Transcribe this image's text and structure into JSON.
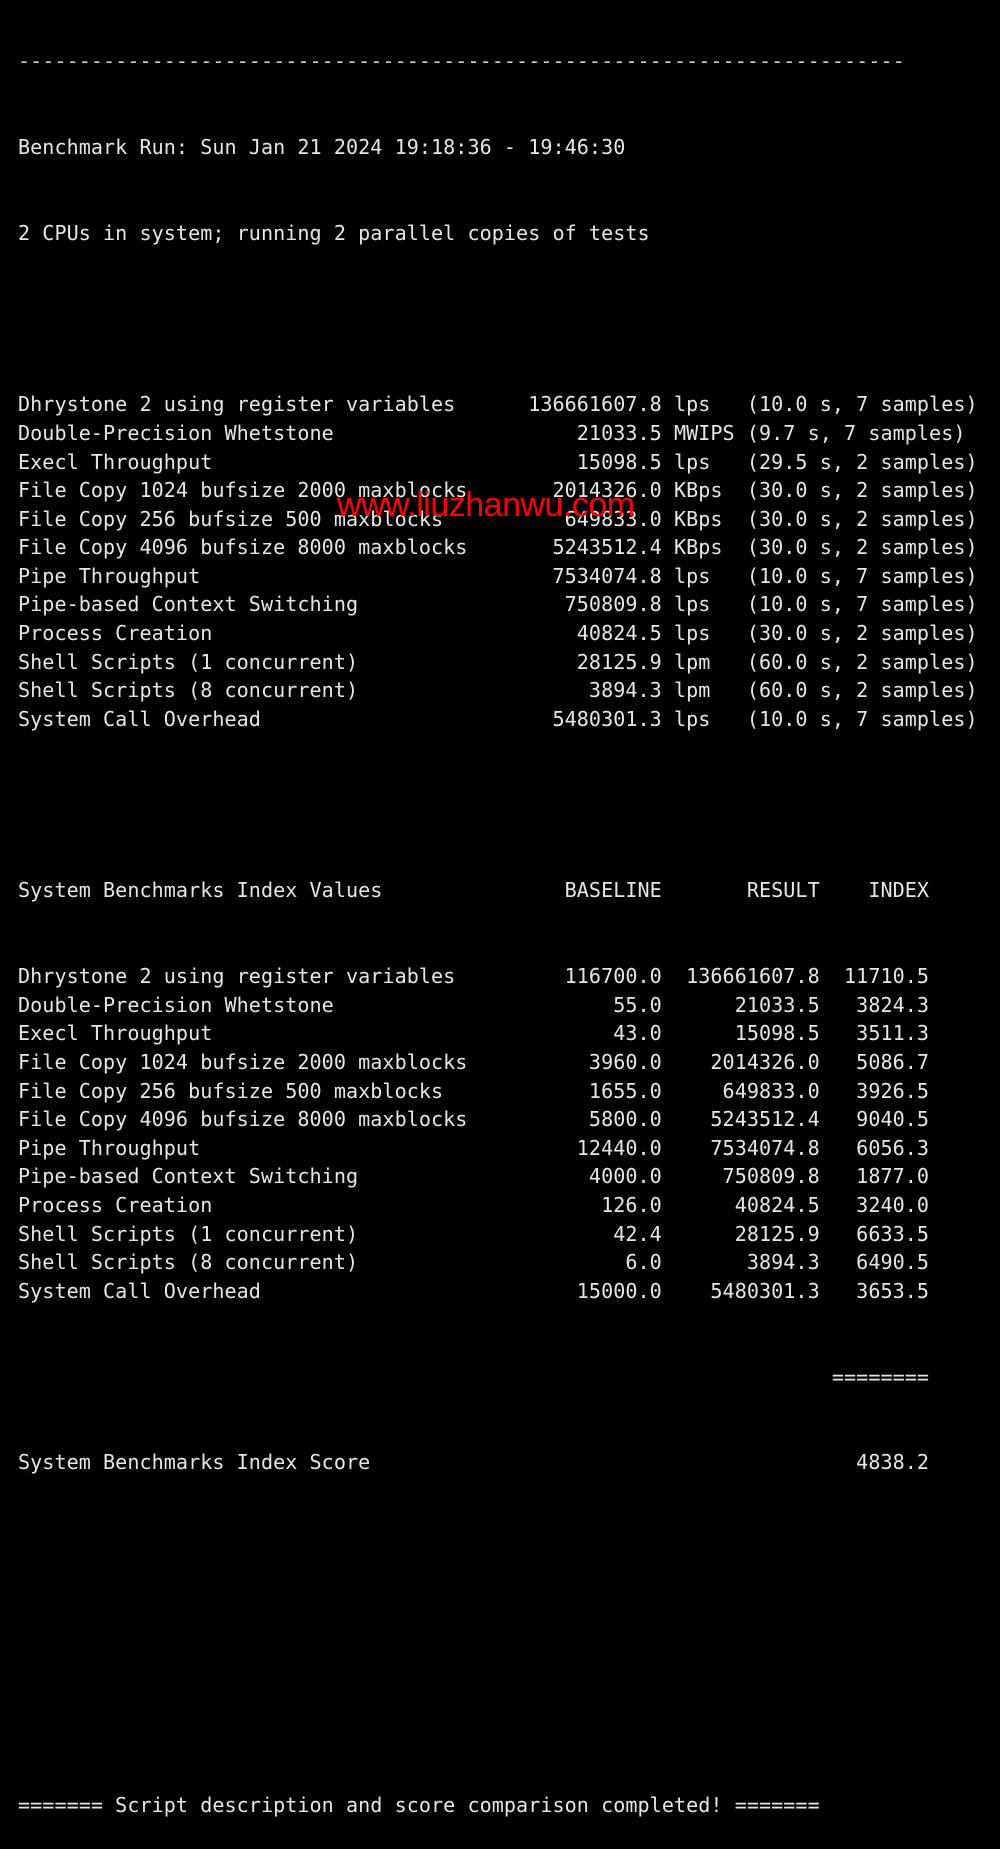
{
  "separator": "-------------------------------------------------------------------------",
  "header": {
    "run_line": "Benchmark Run: Sun Jan 21 2024 19:18:36 - 19:46:30",
    "cpu_line": "2 CPUs in system; running 2 parallel copies of tests"
  },
  "results": [
    {
      "name": "Dhrystone 2 using register variables",
      "value": "136661607.8",
      "unit": "lps",
      "detail": "(10.0 s, 7 samples)"
    },
    {
      "name": "Double-Precision Whetstone",
      "value": "21033.5",
      "unit": "MWIPS",
      "detail": "(9.7 s, 7 samples)"
    },
    {
      "name": "Execl Throughput",
      "value": "15098.5",
      "unit": "lps",
      "detail": "(29.5 s, 2 samples)"
    },
    {
      "name": "File Copy 1024 bufsize 2000 maxblocks",
      "value": "2014326.0",
      "unit": "KBps",
      "detail": "(30.0 s, 2 samples)"
    },
    {
      "name": "File Copy 256 bufsize 500 maxblocks",
      "value": "649833.0",
      "unit": "KBps",
      "detail": "(30.0 s, 2 samples)"
    },
    {
      "name": "File Copy 4096 bufsize 8000 maxblocks",
      "value": "5243512.4",
      "unit": "KBps",
      "detail": "(30.0 s, 2 samples)"
    },
    {
      "name": "Pipe Throughput",
      "value": "7534074.8",
      "unit": "lps",
      "detail": "(10.0 s, 7 samples)"
    },
    {
      "name": "Pipe-based Context Switching",
      "value": "750809.8",
      "unit": "lps",
      "detail": "(10.0 s, 7 samples)"
    },
    {
      "name": "Process Creation",
      "value": "40824.5",
      "unit": "lps",
      "detail": "(30.0 s, 2 samples)"
    },
    {
      "name": "Shell Scripts (1 concurrent)",
      "value": "28125.9",
      "unit": "lpm",
      "detail": "(60.0 s, 2 samples)"
    },
    {
      "name": "Shell Scripts (8 concurrent)",
      "value": "3894.3",
      "unit": "lpm",
      "detail": "(60.0 s, 2 samples)"
    },
    {
      "name": "System Call Overhead",
      "value": "5480301.3",
      "unit": "lps",
      "detail": "(10.0 s, 7 samples)"
    }
  ],
  "index": {
    "title": "System Benchmarks Index Values",
    "columns": [
      "BASELINE",
      "RESULT",
      "INDEX"
    ],
    "rows": [
      {
        "name": "Dhrystone 2 using register variables",
        "baseline": "116700.0",
        "result": "136661607.8",
        "index": "11710.5"
      },
      {
        "name": "Double-Precision Whetstone",
        "baseline": "55.0",
        "result": "21033.5",
        "index": "3824.3"
      },
      {
        "name": "Execl Throughput",
        "baseline": "43.0",
        "result": "15098.5",
        "index": "3511.3"
      },
      {
        "name": "File Copy 1024 bufsize 2000 maxblocks",
        "baseline": "3960.0",
        "result": "2014326.0",
        "index": "5086.7"
      },
      {
        "name": "File Copy 256 bufsize 500 maxblocks",
        "baseline": "1655.0",
        "result": "649833.0",
        "index": "3926.5"
      },
      {
        "name": "File Copy 4096 bufsize 8000 maxblocks",
        "baseline": "5800.0",
        "result": "5243512.4",
        "index": "9040.5"
      },
      {
        "name": "Pipe Throughput",
        "baseline": "12440.0",
        "result": "7534074.8",
        "index": "6056.3"
      },
      {
        "name": "Pipe-based Context Switching",
        "baseline": "4000.0",
        "result": "750809.8",
        "index": "1877.0"
      },
      {
        "name": "Process Creation",
        "baseline": "126.0",
        "result": "40824.5",
        "index": "3240.0"
      },
      {
        "name": "Shell Scripts (1 concurrent)",
        "baseline": "42.4",
        "result": "28125.9",
        "index": "6633.5"
      },
      {
        "name": "Shell Scripts (8 concurrent)",
        "baseline": "6.0",
        "result": "3894.3",
        "index": "6490.5"
      },
      {
        "name": "System Call Overhead",
        "baseline": "15000.0",
        "result": "5480301.3",
        "index": "3653.5"
      }
    ],
    "total_separator": "========",
    "score_label": "System Benchmarks Index Score",
    "score": "4838.2"
  },
  "footer": "======= Script description and score comparison completed! =======",
  "watermark": "www.liuzhanwu.com"
}
